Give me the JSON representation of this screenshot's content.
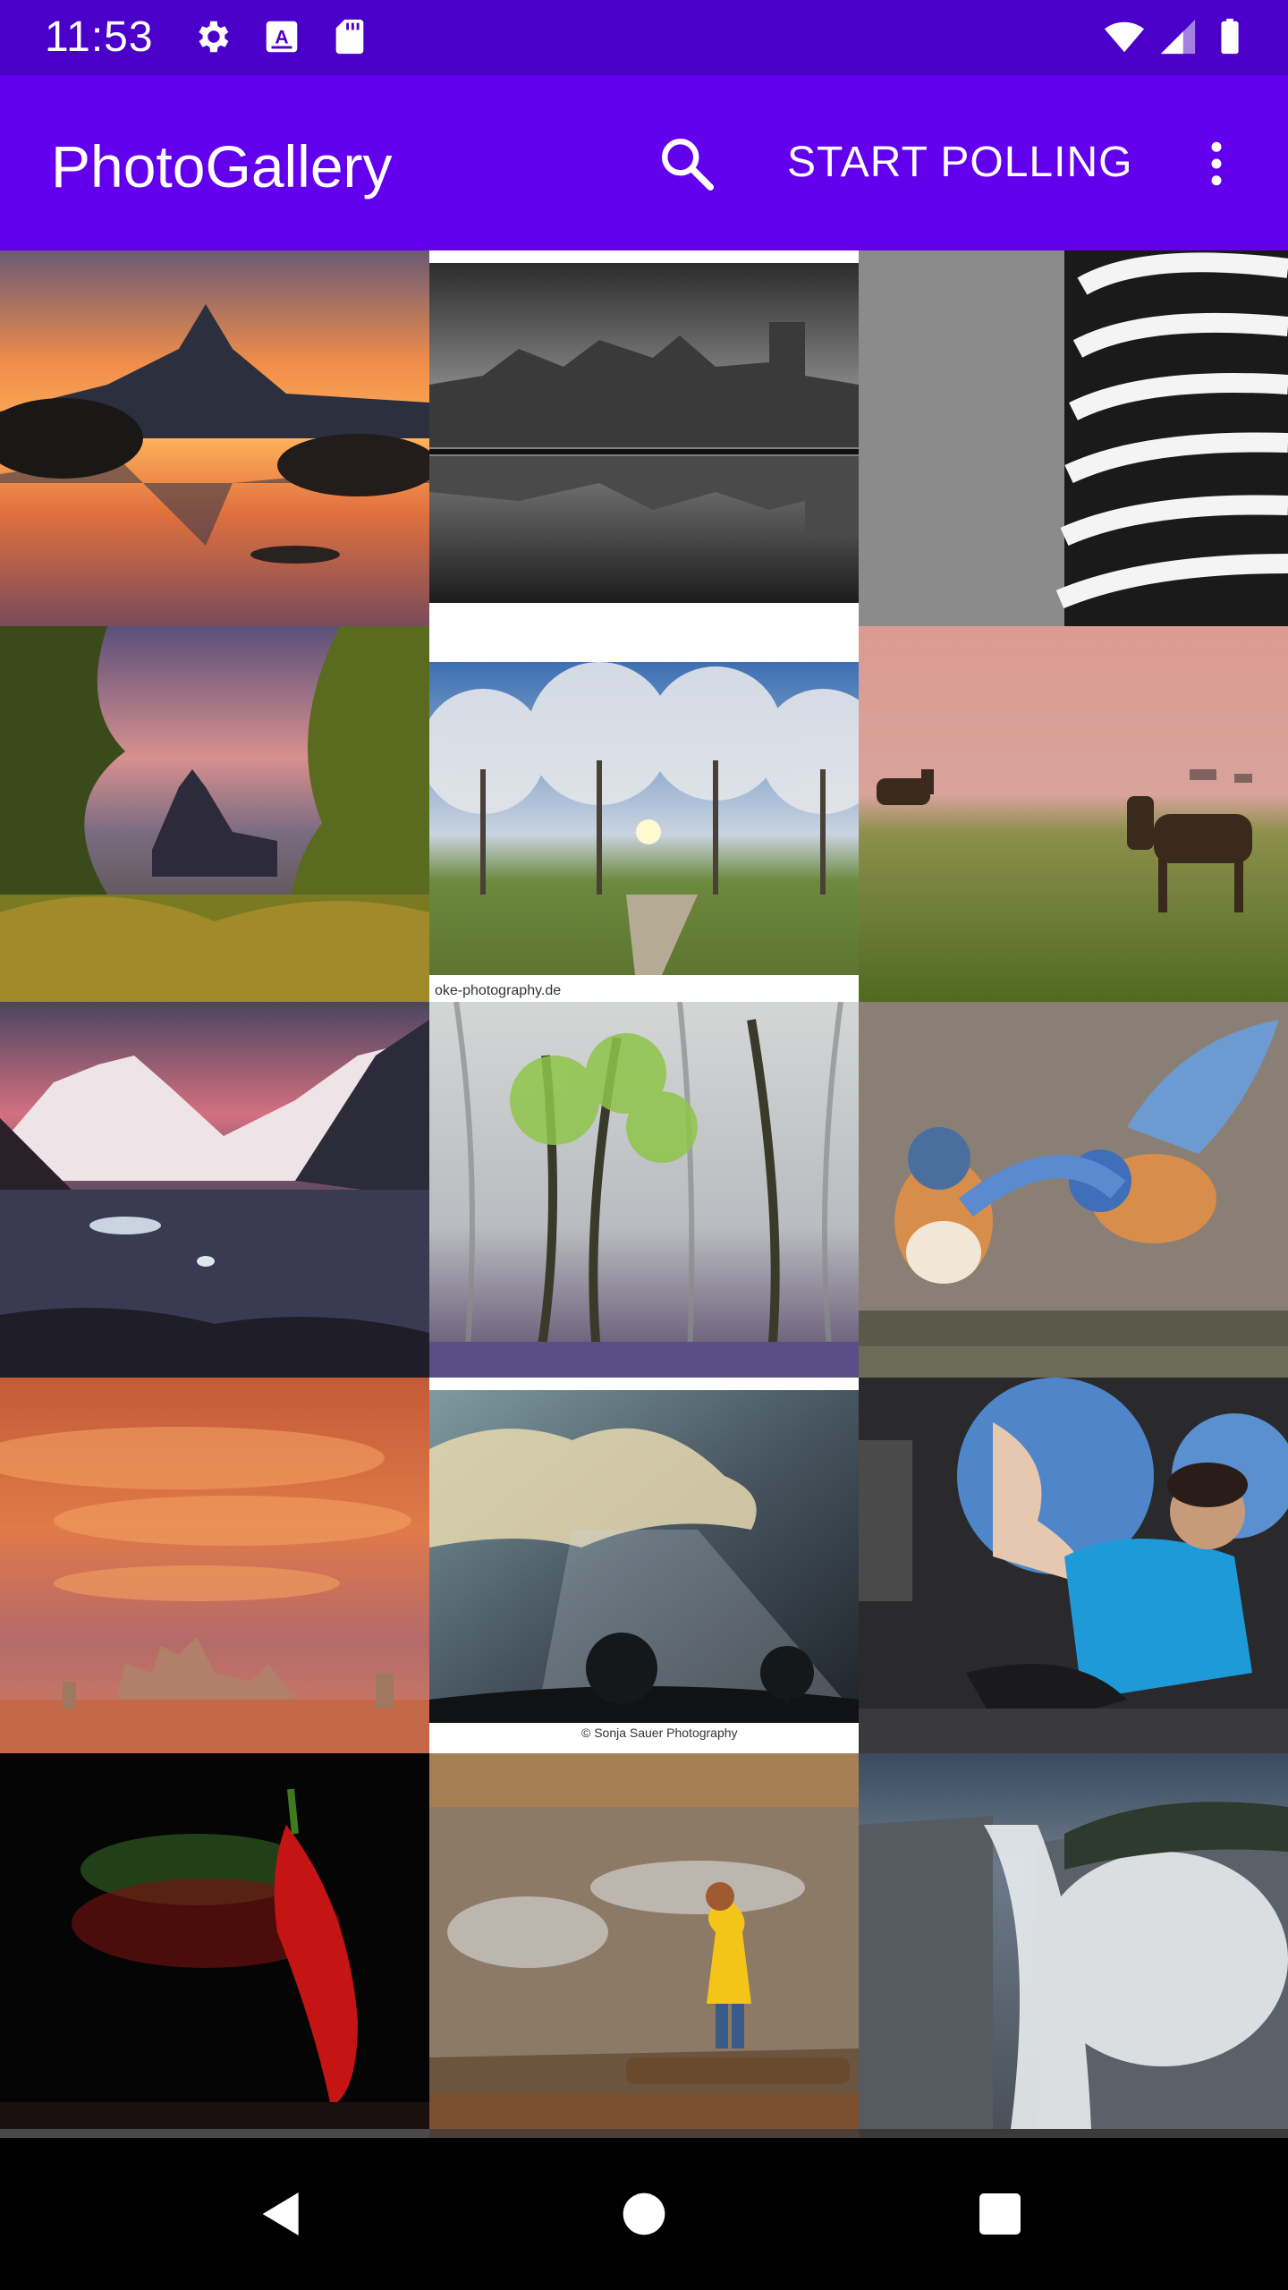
{
  "status_bar": {
    "time": "11:53",
    "icons": [
      "gear-icon",
      "keyboard-a-icon",
      "sd-card-icon",
      "wifi-icon",
      "signal-icon",
      "battery-icon"
    ]
  },
  "app_bar": {
    "title": "PhotoGallery",
    "search_icon": "search-icon",
    "start_polling_label": "START POLLING",
    "overflow_icon": "more-vert-icon"
  },
  "gallery": {
    "columns": 3,
    "photos": [
      {
        "subject": "mountain lake sunset reflection"
      },
      {
        "subject": "black and white museum reflection"
      },
      {
        "subject": "spiral building balconies"
      },
      {
        "subject": "castle in autumn forest"
      },
      {
        "subject": "blossoming trees avenue",
        "caption": "oke-photography.de"
      },
      {
        "subject": "horses in foggy meadow"
      },
      {
        "subject": "patagonia mountains lake"
      },
      {
        "subject": "misty beech forest bluebells"
      },
      {
        "subject": "bluebirds on branch"
      },
      {
        "subject": "lenticular clouds over rock spires"
      },
      {
        "subject": "sun rays behind clouds over trees",
        "caption": "© Sonja Sauer Photography"
      },
      {
        "subject": "astronaut in space station cupola"
      },
      {
        "subject": "red chili pepper on black"
      },
      {
        "subject": "child in yellow raincoat by puddle"
      },
      {
        "subject": "waterfall canyon"
      }
    ]
  },
  "nav_bar": {
    "back_icon": "back-triangle-icon",
    "home_icon": "home-circle-icon",
    "recents_icon": "recents-square-icon"
  },
  "colors": {
    "status_bar": "#4a00c9",
    "app_bar": "#6200ee"
  }
}
